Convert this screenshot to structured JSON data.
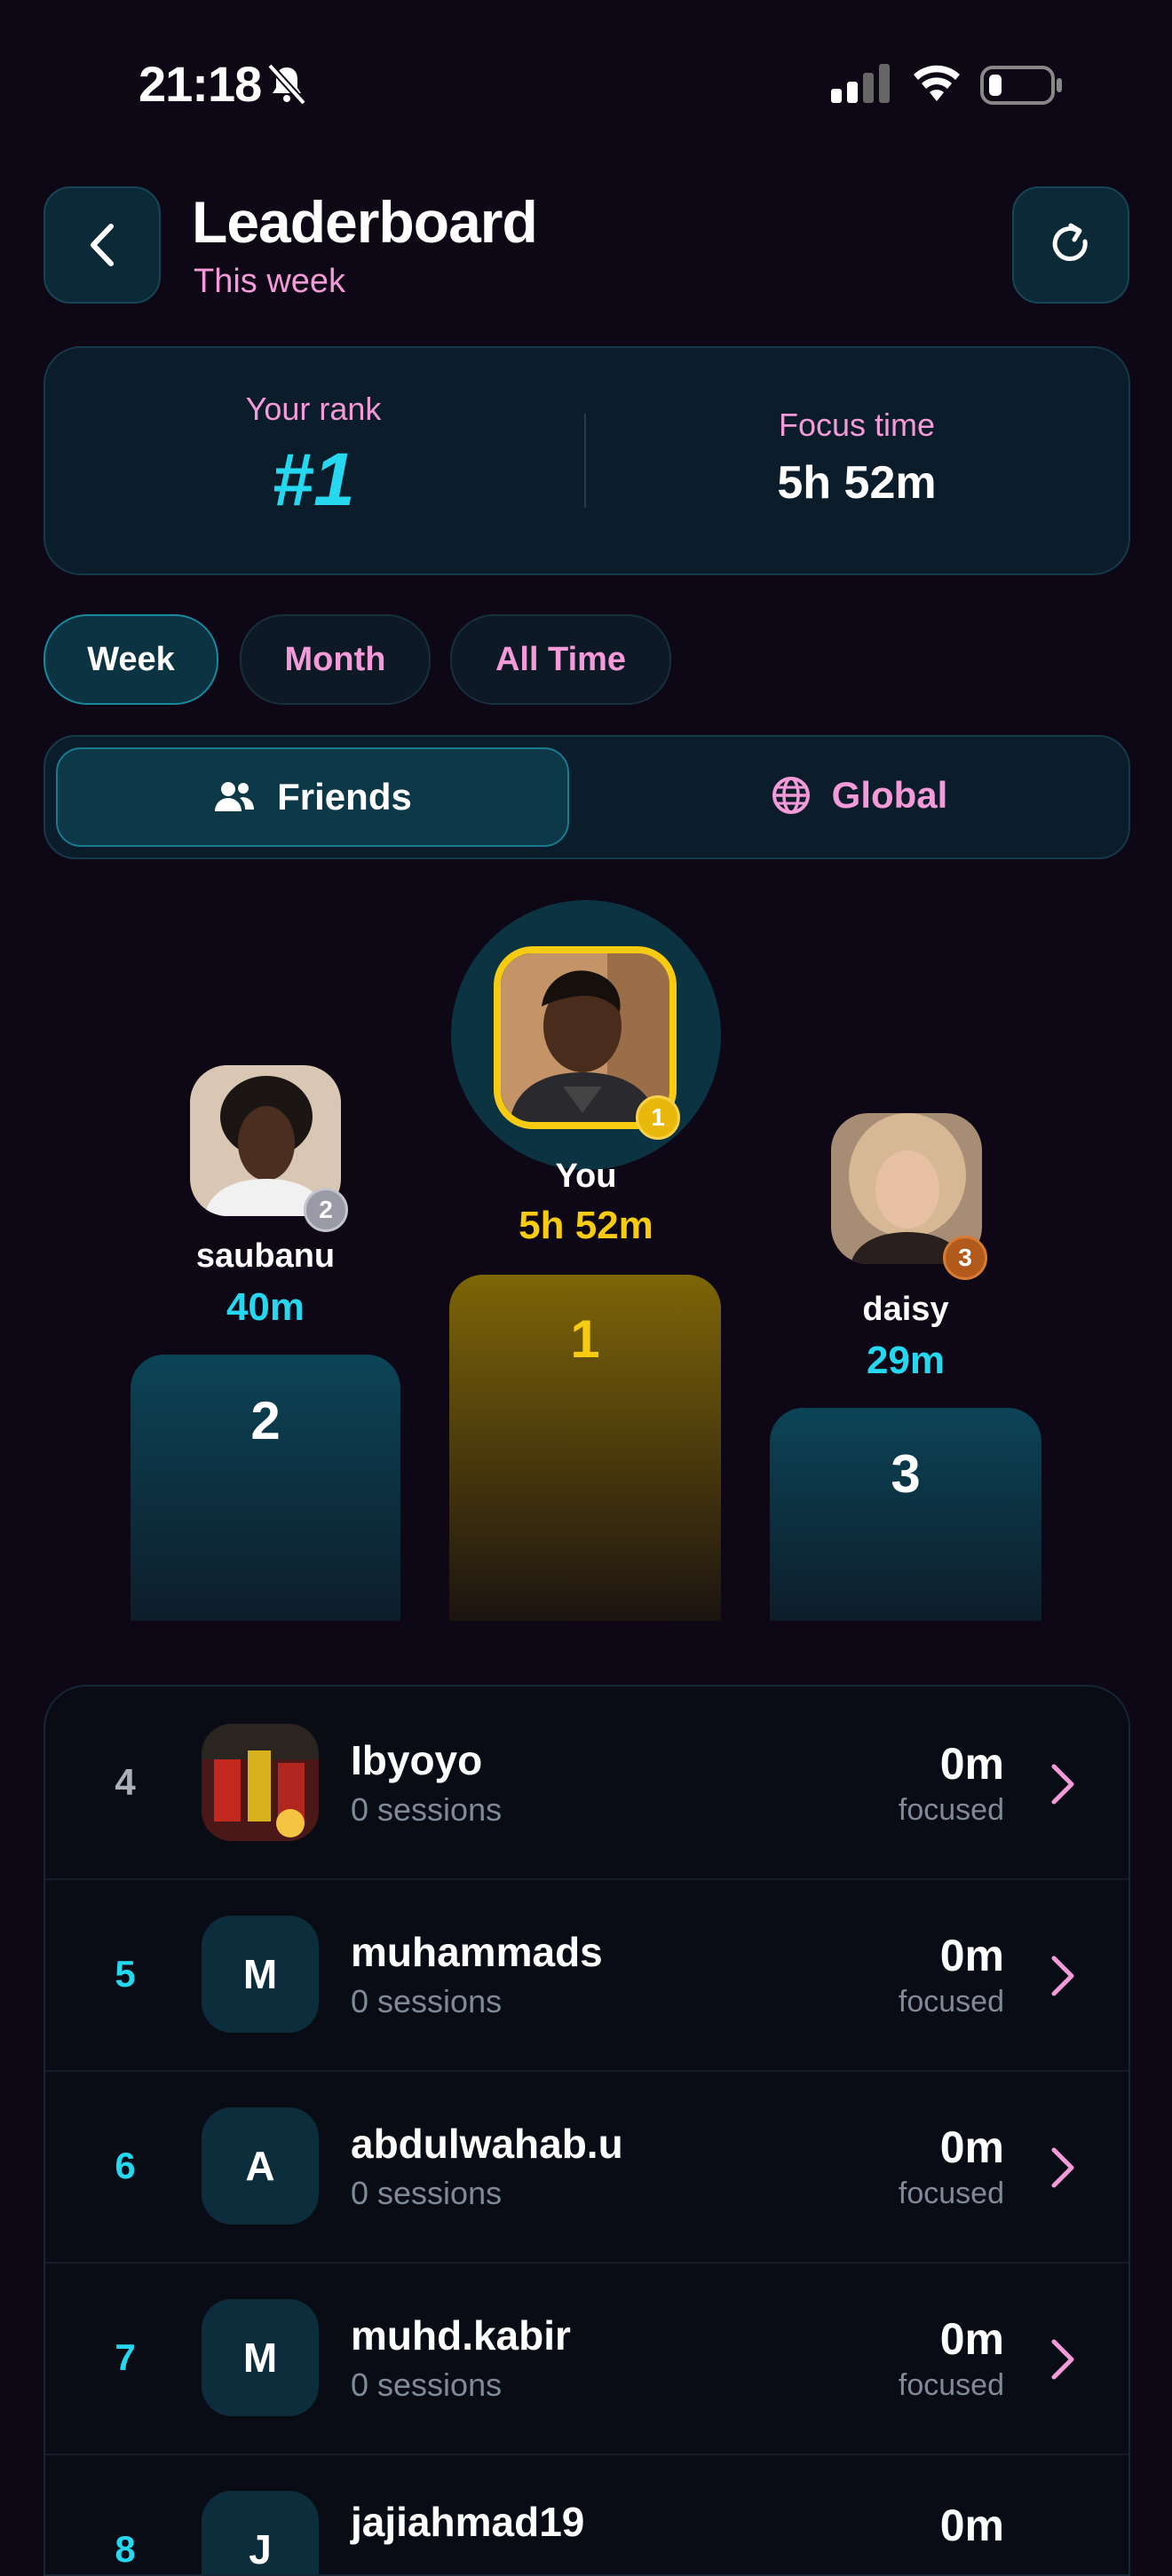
{
  "status_bar": {
    "time": "21:18"
  },
  "header": {
    "title": "Leaderboard",
    "subtitle": "This week"
  },
  "summary": {
    "rank_label": "Your rank",
    "rank_value": "#1",
    "focus_label": "Focus time",
    "focus_value": "5h 52m"
  },
  "period_tabs": [
    {
      "label": "Week",
      "active": true
    },
    {
      "label": "Month",
      "active": false
    },
    {
      "label": "All Time",
      "active": false
    }
  ],
  "scope_tabs": [
    {
      "label": "Friends",
      "icon": "users-icon",
      "active": true
    },
    {
      "label": "Global",
      "icon": "globe-icon",
      "active": false
    }
  ],
  "podium": {
    "first": {
      "rank": "1",
      "name": "You",
      "time": "5h 52m",
      "medal": "1"
    },
    "second": {
      "rank": "2",
      "name": "saubanu",
      "time": "40m",
      "medal": "2"
    },
    "third": {
      "rank": "3",
      "name": "daisy",
      "time": "29m",
      "medal": "3"
    }
  },
  "list": [
    {
      "rank": "4",
      "name": "Ibyoyo",
      "sessions": "0 sessions",
      "value": "0m",
      "unit": "focused",
      "initial": ""
    },
    {
      "rank": "5",
      "name": "muhammads",
      "sessions": "0 sessions",
      "value": "0m",
      "unit": "focused",
      "initial": "M"
    },
    {
      "rank": "6",
      "name": "abdulwahab.u",
      "sessions": "0 sessions",
      "value": "0m",
      "unit": "focused",
      "initial": "A"
    },
    {
      "rank": "7",
      "name": "muhd.kabir",
      "sessions": "0 sessions",
      "value": "0m",
      "unit": "focused",
      "initial": "M"
    },
    {
      "rank": "8",
      "name": "jajiahmad19",
      "sessions": "",
      "value": "0m",
      "unit": "",
      "initial": "J"
    }
  ],
  "colors": {
    "accent_cyan": "#25d7ef",
    "accent_pink": "#f59ad8",
    "gold": "#f7cb12",
    "background": "#0d0716"
  }
}
